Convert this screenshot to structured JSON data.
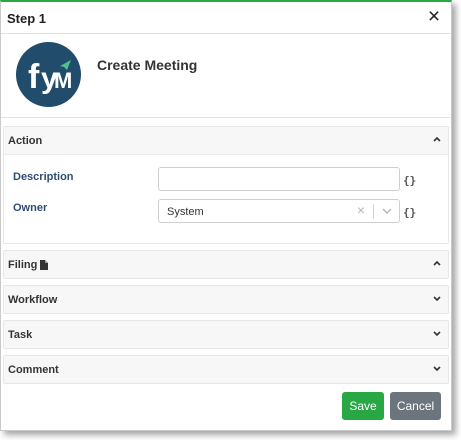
{
  "dialog": {
    "title": "Step 1",
    "close_glyph": "×",
    "app_title": "Create Meeting",
    "logo_icon": "fym-logo-icon"
  },
  "action": {
    "title": "Action",
    "description_label": "Description",
    "description_value": "",
    "owner_label": "Owner",
    "owner_value": "System",
    "brace_glyph": "{}"
  },
  "sections": {
    "filing": "Filing",
    "workflow": "Workflow",
    "task": "Task",
    "comment": "Comment"
  },
  "buttons": {
    "save": "Save",
    "cancel": "Cancel"
  },
  "colors": {
    "accent": "#28a745",
    "logo_bg": "#214c6b",
    "label": "#2f4d72",
    "cancel": "#6c757d"
  }
}
